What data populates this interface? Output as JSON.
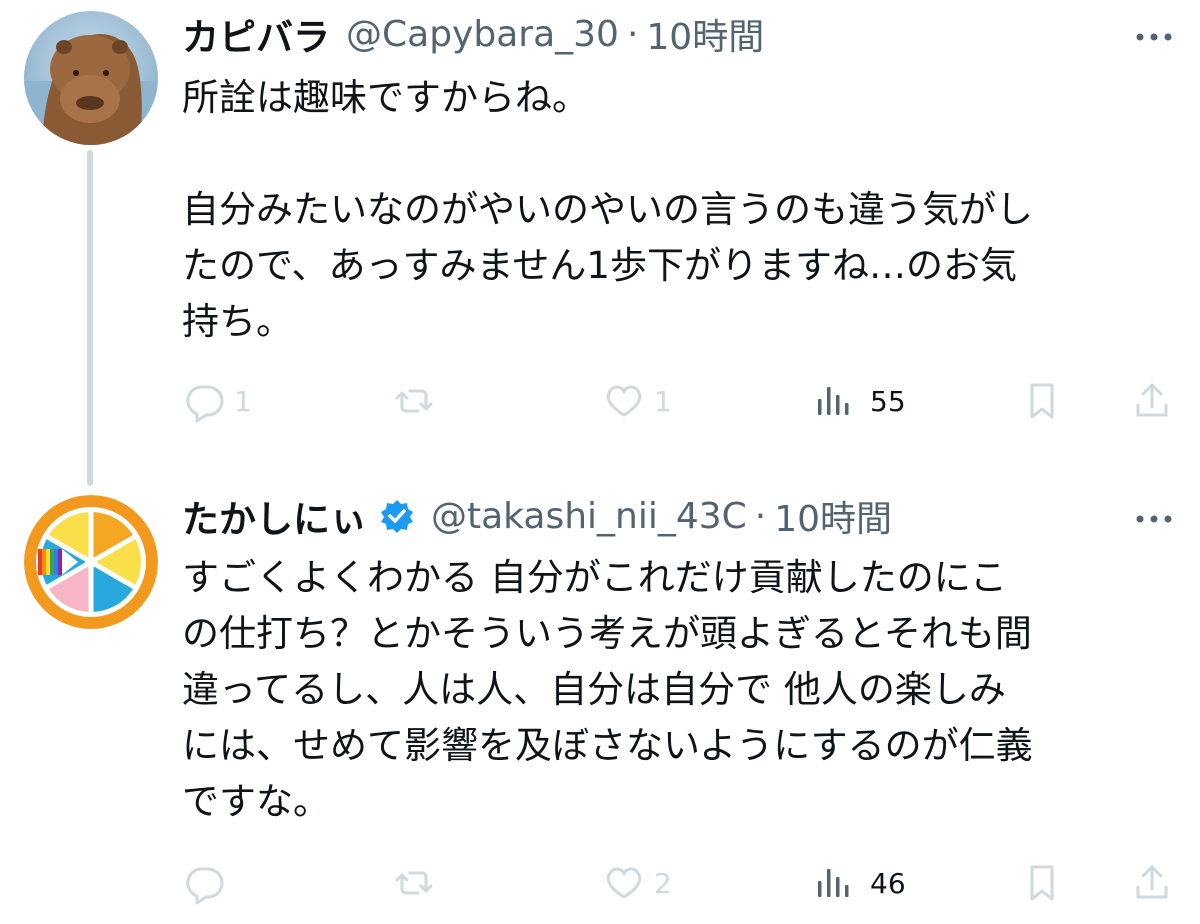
{
  "colors": {
    "text_primary": "#0f1419",
    "text_secondary": "#536471",
    "thread_line": "#cfd9de",
    "verified_blue": "#1d9bf0"
  },
  "tweets": [
    {
      "display_name": "カピバラ",
      "handle": "@Capybara_30",
      "separator": "·",
      "time": "10時間",
      "verified": false,
      "text_lines": [
        "所詮は趣味ですからね。",
        "",
        "自分みたいなのがやいのやいの言うのも違う気がし",
        "たので、あっすみません1歩下がりますね…のお気",
        "持ち。"
      ],
      "actions": {
        "reply": "1",
        "retweet": "",
        "like": "1",
        "views": "55"
      }
    },
    {
      "display_name": "たかしにぃ",
      "handle": "@takashi_nii_43C",
      "separator": "·",
      "time": "10時間",
      "verified": true,
      "text_lines": [
        "すごくよくわかる 自分がこれだけ貢献したのにこ",
        "の仕打ち？とかそういう考えが頭よぎるとそれも間",
        "違ってるし、人は人、自分は自分で 他人の楽しみ",
        "には、せめて影響を及ぼさないようにするのが仁義",
        "ですな。"
      ],
      "actions": {
        "reply": "",
        "retweet": "",
        "like": "2",
        "views": "46"
      }
    }
  ],
  "icons": {
    "reply": "reply-icon",
    "retweet": "retweet-icon",
    "like": "like-icon",
    "views": "views-icon",
    "bookmark": "bookmark-icon",
    "share": "share-icon",
    "more": "more-icon",
    "verified": "verified-badge-icon"
  }
}
